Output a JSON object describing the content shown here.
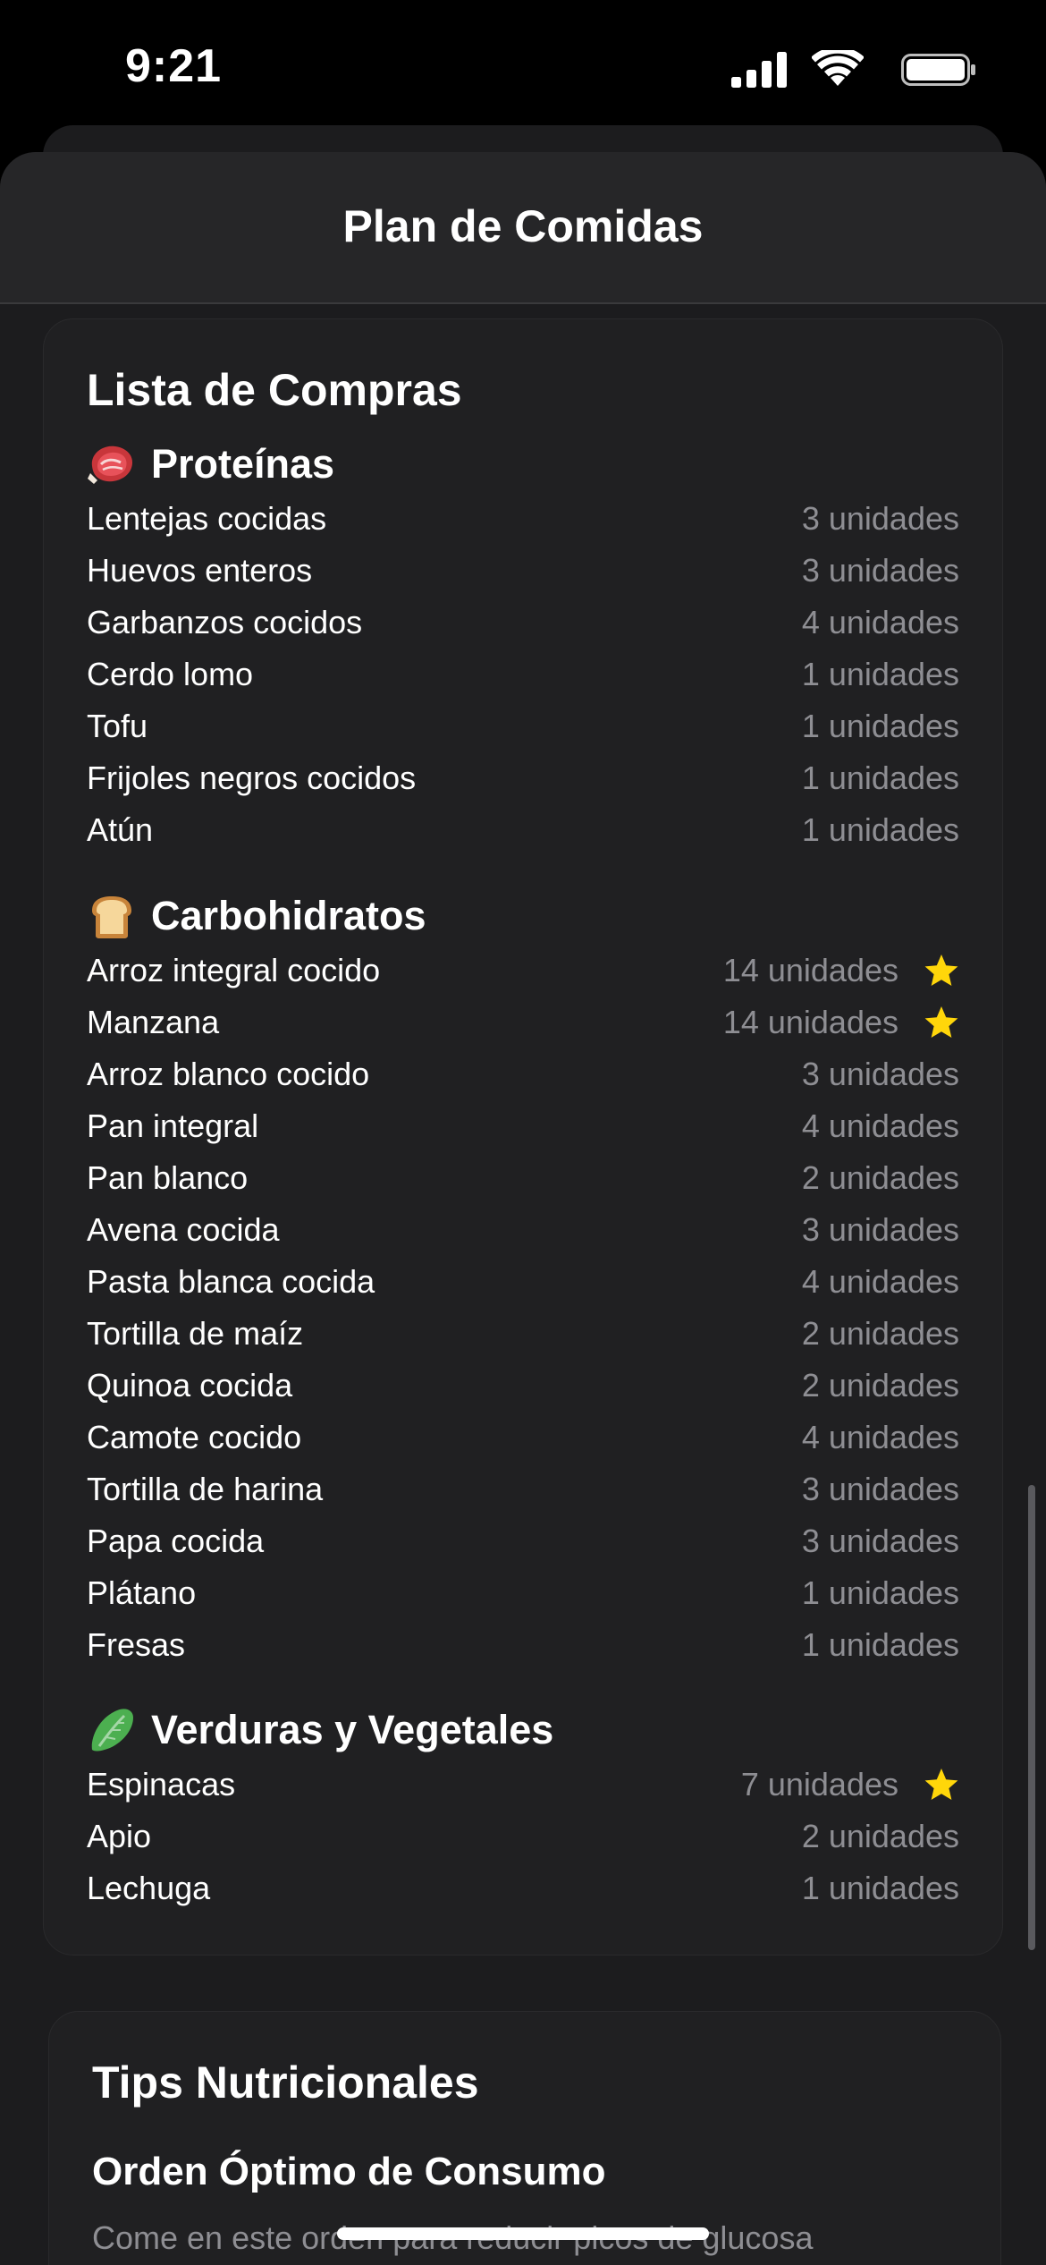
{
  "status_bar": {
    "time": "9:21"
  },
  "header": {
    "title": "Plan de Comidas"
  },
  "shopping_list": {
    "title": "Lista de Compras",
    "categories": [
      {
        "name": "Proteínas",
        "icon": "steak-emoji-icon",
        "items": [
          {
            "name": "Lentejas cocidas",
            "qty": "3 unidades",
            "starred": false
          },
          {
            "name": "Huevos enteros",
            "qty": "3 unidades",
            "starred": false
          },
          {
            "name": "Garbanzos cocidos",
            "qty": "4 unidades",
            "starred": false
          },
          {
            "name": "Cerdo lomo",
            "qty": "1 unidades",
            "starred": false
          },
          {
            "name": "Tofu",
            "qty": "1 unidades",
            "starred": false
          },
          {
            "name": "Frijoles negros cocidos",
            "qty": "1 unidades",
            "starred": false
          },
          {
            "name": "Atún",
            "qty": "1 unidades",
            "starred": false
          }
        ]
      },
      {
        "name": "Carbohidratos",
        "icon": "bread-emoji-icon",
        "items": [
          {
            "name": "Arroz integral cocido",
            "qty": "14 unidades",
            "starred": true
          },
          {
            "name": "Manzana",
            "qty": "14 unidades",
            "starred": true
          },
          {
            "name": "Arroz blanco cocido",
            "qty": "3 unidades",
            "starred": false
          },
          {
            "name": "Pan integral",
            "qty": "4 unidades",
            "starred": false
          },
          {
            "name": "Pan blanco",
            "qty": "2 unidades",
            "starred": false
          },
          {
            "name": "Avena cocida",
            "qty": "3 unidades",
            "starred": false
          },
          {
            "name": "Pasta blanca cocida",
            "qty": "4 unidades",
            "starred": false
          },
          {
            "name": "Tortilla de maíz",
            "qty": "2 unidades",
            "starred": false
          },
          {
            "name": "Quinoa cocida",
            "qty": "2 unidades",
            "starred": false
          },
          {
            "name": "Camote cocido",
            "qty": "4 unidades",
            "starred": false
          },
          {
            "name": "Tortilla de harina",
            "qty": "3 unidades",
            "starred": false
          },
          {
            "name": "Papa cocida",
            "qty": "3 unidades",
            "starred": false
          },
          {
            "name": "Plátano",
            "qty": "1 unidades",
            "starred": false
          },
          {
            "name": "Fresas",
            "qty": "1 unidades",
            "starred": false
          }
        ]
      },
      {
        "name": "Verduras y Vegetales",
        "icon": "leafy-green-emoji-icon",
        "items": [
          {
            "name": "Espinacas",
            "qty": "7 unidades",
            "starred": true
          },
          {
            "name": "Apio",
            "qty": "2 unidades",
            "starred": false
          },
          {
            "name": "Lechuga",
            "qty": "1 unidades",
            "starred": false
          }
        ]
      }
    ]
  },
  "tips": {
    "title": "Tips Nutricionales",
    "subtitle": "Orden Óptimo de Consumo",
    "description": "Come en este orden para reducir picos de glucosa"
  },
  "colors": {
    "background": "#000000",
    "sheet": "#1c1c1e",
    "card": "#202022",
    "secondary_text": "#8e8e93",
    "star": "#ffd60a"
  }
}
